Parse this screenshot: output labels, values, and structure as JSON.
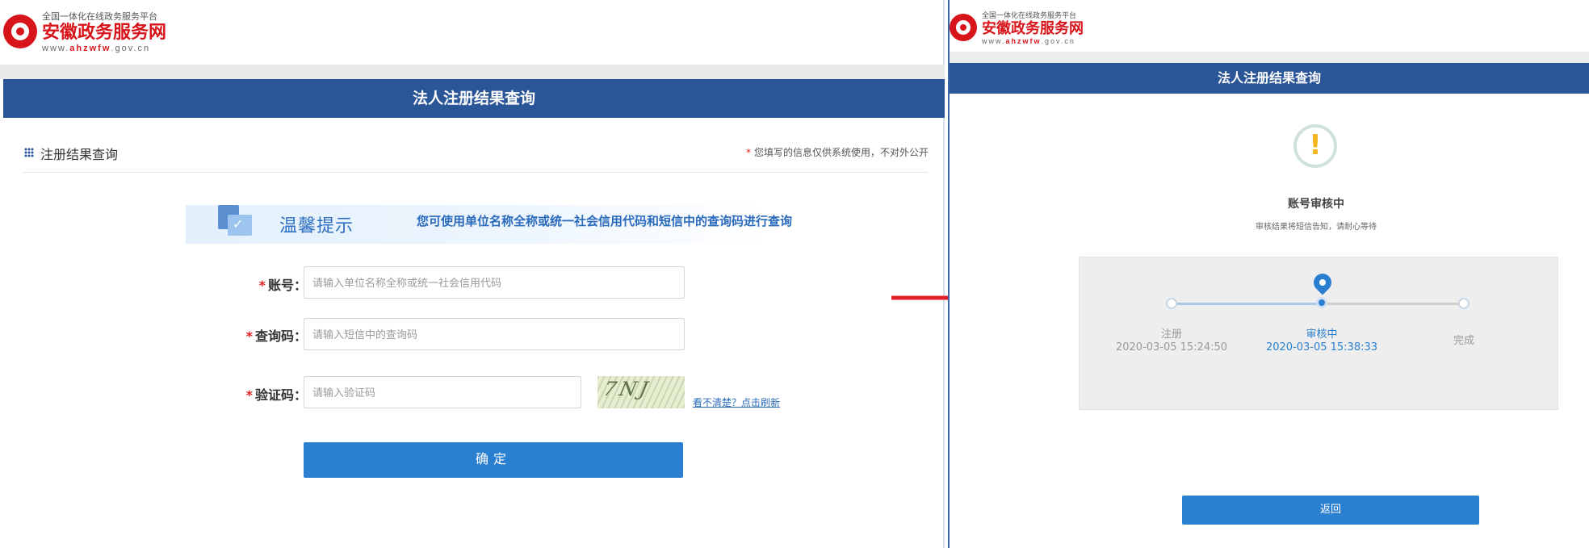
{
  "logo": {
    "platform_name": "全国一体化在线政务服务平台",
    "site_name": "安徽政务服务网",
    "url_prefix": "www.",
    "url_brand": "ahzwfw",
    "url_suffix": ".gov.cn"
  },
  "left": {
    "title": "法人注册结果查询",
    "section_title": "注册结果查询",
    "privacy_note": "您填写的信息仅供系统使用，不对外公开",
    "tip": {
      "title": "温馨提示",
      "text": "您可使用单位名称全称或统一社会信用代码和短信中的查询码进行查询"
    },
    "form": {
      "required_mark": "*",
      "account_label": "账号：",
      "account_placeholder": "请输入单位名称全称或统一社会信用代码",
      "query_label": "查询码：",
      "query_placeholder": "请输入短信中的查询码",
      "captcha_label": "验证码：",
      "captcha_placeholder": "请输入验证码",
      "captcha_code": "7NJ",
      "refresh_link": "看不清楚？点击刷新",
      "submit_label": "确定"
    }
  },
  "right": {
    "title": "法人注册结果查询",
    "status_icon": "!",
    "status_title": "账号审核中",
    "status_subtitle": "审核结果将短信告知，请耐心等待",
    "steps": [
      {
        "label": "注册",
        "time": "2020-03-05 15:24:50",
        "active": false
      },
      {
        "label": "审核中",
        "time": "2020-03-05 15:38:33",
        "active": true
      },
      {
        "label": "完成",
        "time": "",
        "active": false
      }
    ],
    "back_label": "返回"
  },
  "colors": {
    "brand_red": "#d8141b",
    "header_blue": "#2a5597",
    "button_blue": "#2a7fd1",
    "arrow_red": "#e0202a"
  }
}
